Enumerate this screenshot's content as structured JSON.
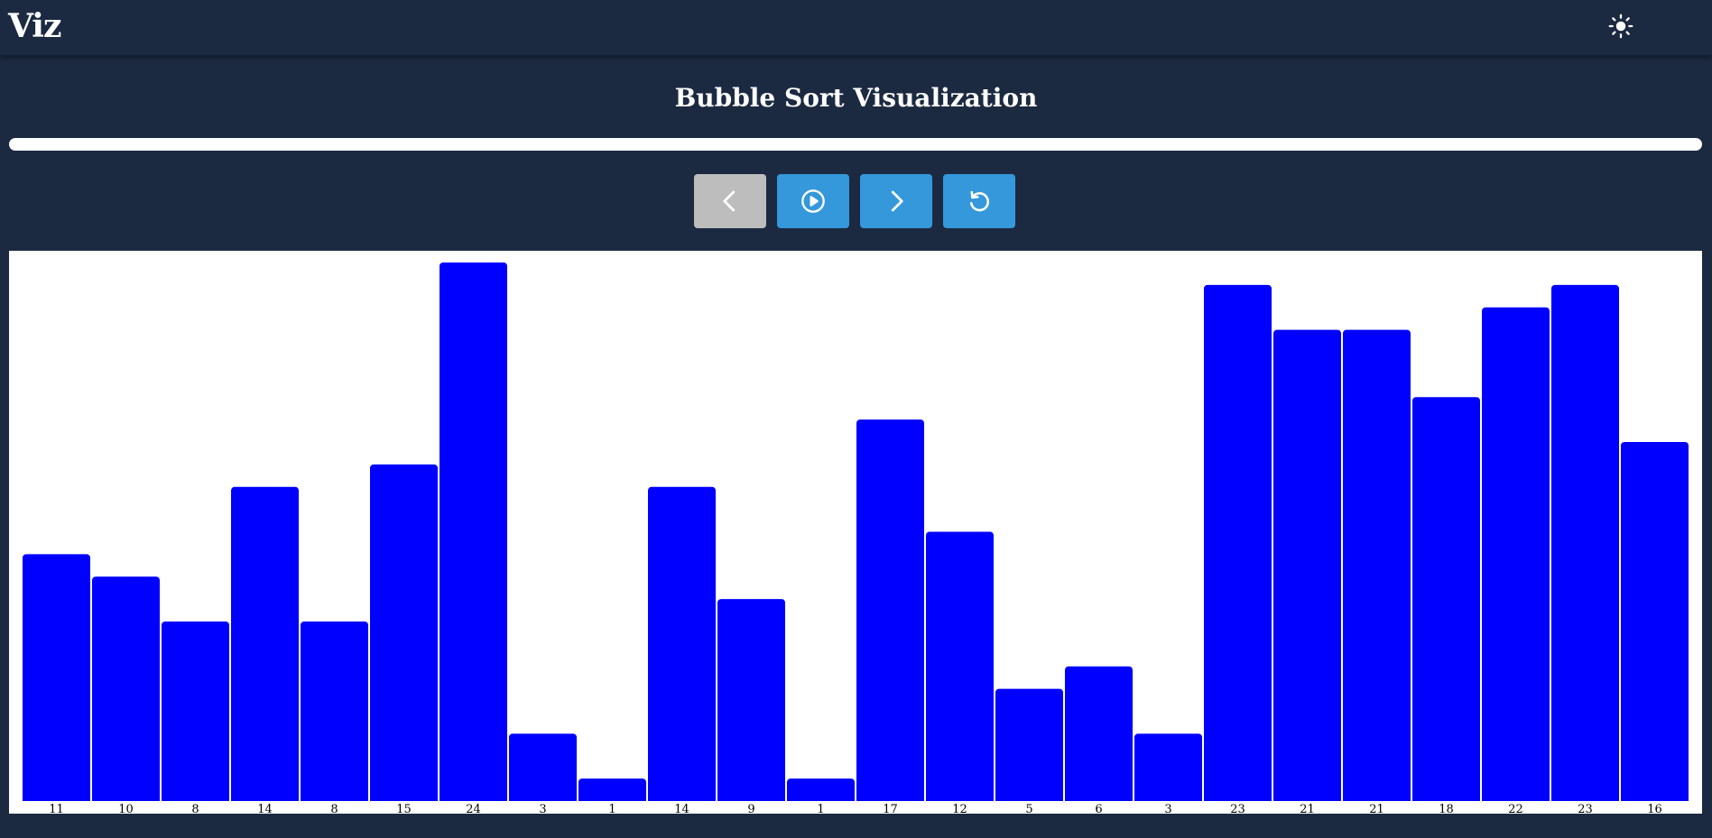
{
  "app": {
    "logo": "Viz"
  },
  "header": {
    "theme_icon": "sun-icon"
  },
  "main": {
    "title": "Bubble Sort Visualization",
    "progress_fraction": 0
  },
  "controls": [
    {
      "name": "previous-step-button",
      "icon": "chevron-left-icon",
      "disabled": true
    },
    {
      "name": "play-button",
      "icon": "play-circle-icon",
      "disabled": false
    },
    {
      "name": "next-step-button",
      "icon": "chevron-right-icon",
      "disabled": false
    },
    {
      "name": "reset-button",
      "icon": "rotate-ccw-icon",
      "disabled": false
    }
  ],
  "colors": {
    "background": "#1b2a41",
    "accent": "#3498db",
    "disabled": "#bdbdbd",
    "bar": "#0000ff",
    "chart_bg": "#ffffff"
  },
  "chart_data": {
    "type": "bar",
    "categories": [
      "11",
      "10",
      "8",
      "14",
      "8",
      "15",
      "24",
      "3",
      "1",
      "14",
      "9",
      "1",
      "17",
      "12",
      "5",
      "6",
      "3",
      "23",
      "21",
      "21",
      "18",
      "22",
      "23",
      "16"
    ],
    "values": [
      11,
      10,
      8,
      14,
      8,
      15,
      24,
      3,
      1,
      14,
      9,
      1,
      17,
      12,
      5,
      6,
      3,
      23,
      21,
      21,
      18,
      22,
      23,
      16
    ],
    "title": "",
    "xlabel": "",
    "ylabel": "",
    "ylim": [
      0,
      24
    ],
    "grid": false
  }
}
